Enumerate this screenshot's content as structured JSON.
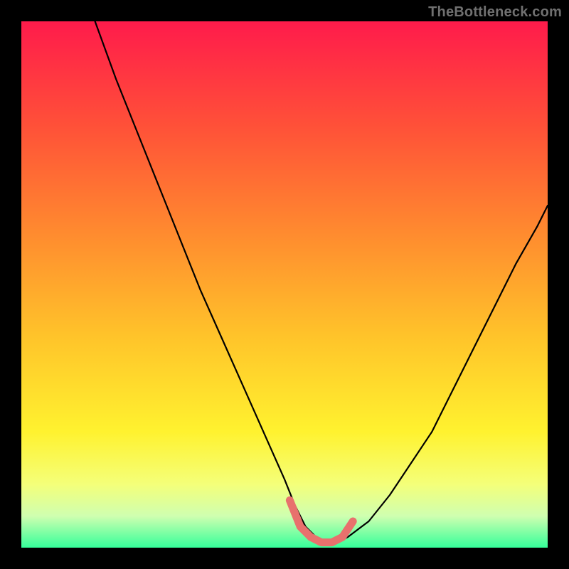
{
  "watermark": "TheBottleneck.com",
  "palette": {
    "background": "#000000",
    "curve": "#000000",
    "marker": "#e8716d",
    "gradient_stops": [
      {
        "offset": 0.0,
        "color": "#ff1b4b"
      },
      {
        "offset": 0.2,
        "color": "#ff5138"
      },
      {
        "offset": 0.4,
        "color": "#ff8a2f"
      },
      {
        "offset": 0.6,
        "color": "#ffc42a"
      },
      {
        "offset": 0.78,
        "color": "#fff22f"
      },
      {
        "offset": 0.88,
        "color": "#f4ff7a"
      },
      {
        "offset": 0.94,
        "color": "#cfffb0"
      },
      {
        "offset": 1.0,
        "color": "#35ff9a"
      }
    ]
  },
  "chart_data": {
    "type": "line",
    "title": "",
    "xlabel": "",
    "ylabel": "",
    "xlim": [
      0,
      100
    ],
    "ylim": [
      0,
      100
    ],
    "series": [
      {
        "name": "bottleneck-curve",
        "x": [
          14,
          18,
          22,
          26,
          30,
          34,
          38,
          42,
          46,
          50,
          52,
          54,
          56,
          58,
          60,
          62,
          66,
          70,
          74,
          78,
          82,
          86,
          90,
          94,
          98,
          100
        ],
        "y": [
          100,
          89,
          79,
          69,
          59,
          49,
          40,
          31,
          22,
          13,
          8,
          4,
          2,
          1,
          1,
          2,
          5,
          10,
          16,
          22,
          30,
          38,
          46,
          54,
          61,
          65
        ]
      }
    ],
    "marker_segment": {
      "name": "optimal-range",
      "x": [
        51,
        53,
        55,
        57,
        59,
        61,
        63
      ],
      "y": [
        9,
        4,
        2,
        1,
        1,
        2,
        5
      ]
    }
  }
}
